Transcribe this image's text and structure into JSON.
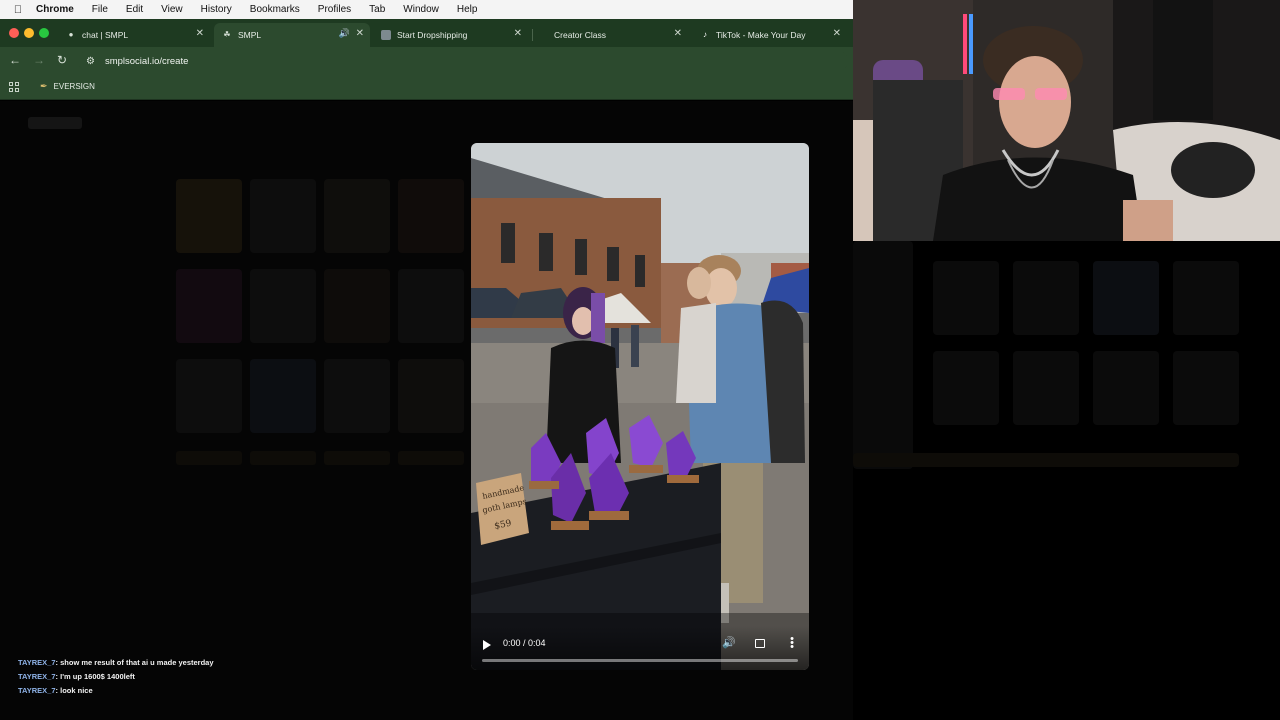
{
  "menubar": {
    "app": "Chrome",
    "items": [
      "File",
      "Edit",
      "View",
      "History",
      "Bookmarks",
      "Profiles",
      "Tab",
      "Window",
      "Help"
    ]
  },
  "tabs": [
    {
      "label": "chat | SMPL",
      "icon": "smpl-icon",
      "active": false
    },
    {
      "label": "SMPL",
      "icon": "smpl-icon",
      "active": true,
      "audio": true
    },
    {
      "label": "Start Dropshipping",
      "icon": "cube-icon",
      "active": false
    },
    {
      "label": "Creator Class",
      "icon": "blank-icon",
      "active": false
    },
    {
      "label": "TikTok - Make Your Day",
      "icon": "tiktok-icon",
      "active": false
    }
  ],
  "toolbar": {
    "url": "smplsocial.io/create"
  },
  "bookmarks": {
    "items": [
      {
        "label": "EVERSIGN",
        "icon": "feather-icon"
      }
    ]
  },
  "video": {
    "time": "0:00 / 0:04",
    "progress": 0,
    "sign_text": [
      "handmade",
      "goth lamps",
      "$59"
    ]
  },
  "chat": [
    {
      "user": "TAYREX_7",
      "message": "show me result of that ai u made yesterday"
    },
    {
      "user": "TAYREX_7",
      "message": "I'm up 1600$ 1400left"
    },
    {
      "user": "TAYREX_7",
      "message": "look nice"
    }
  ],
  "colors": {
    "tab_strip": "#1e3a21",
    "toolbar": "#2c4a2e",
    "chat_user": "#8fb3e8"
  }
}
